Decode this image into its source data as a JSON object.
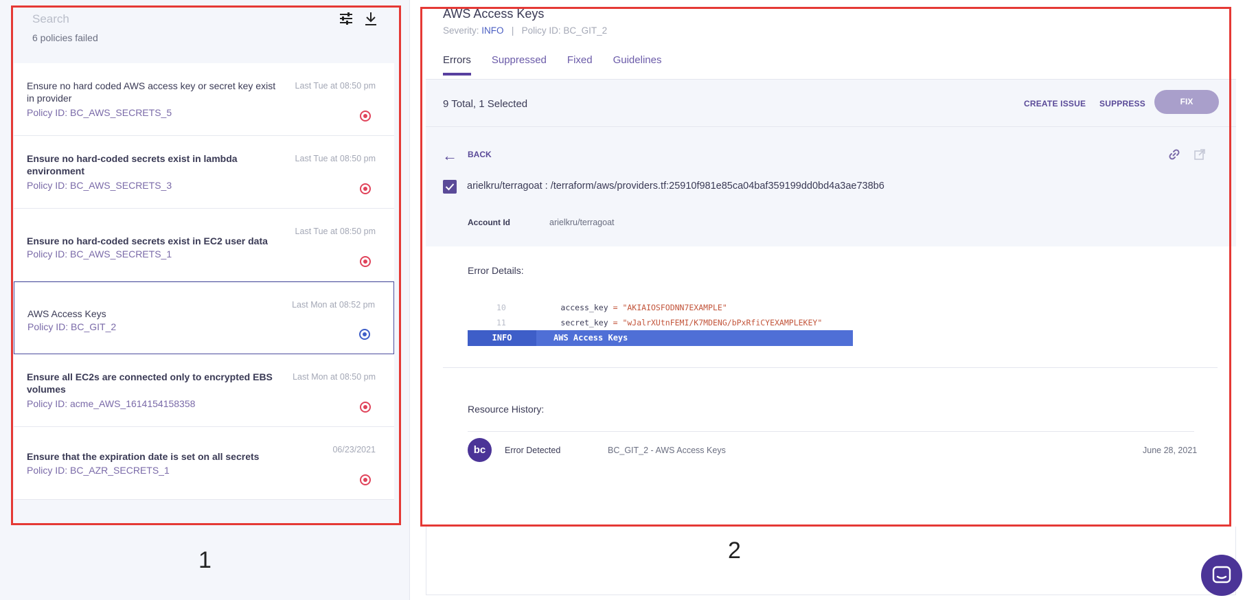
{
  "left": {
    "search_placeholder": "Search",
    "failed_count": "6 policies failed",
    "items": [
      {
        "title": "Ensure no hard coded AWS access key or secret key exist in provider",
        "policy": "Policy ID: BC_AWS_SECRETS_5",
        "time": "Last Tue at 08:50 pm",
        "status": "error"
      },
      {
        "title": "Ensure no hard-coded secrets exist in lambda environment",
        "policy": "Policy ID: BC_AWS_SECRETS_3",
        "time": "Last Tue at 08:50 pm",
        "status": "error"
      },
      {
        "title": "Ensure no hard-coded secrets exist in EC2 user data",
        "policy": "Policy ID: BC_AWS_SECRETS_1",
        "time": "Last Tue at 08:50 pm",
        "status": "error"
      },
      {
        "title": "AWS Access Keys",
        "policy": "Policy ID: BC_GIT_2",
        "time": "Last Mon at 08:52 pm",
        "status": "info"
      },
      {
        "title": "Ensure all EC2s are connected only to encrypted EBS volumes",
        "policy": "Policy ID: acme_AWS_1614154158358",
        "time": "Last Mon at 08:50 pm",
        "status": "error"
      },
      {
        "title": "Ensure that the expiration date is set on all secrets",
        "policy": "Policy ID: BC_AZR_SECRETS_1",
        "time": "06/23/2021",
        "status": "error"
      }
    ]
  },
  "detail": {
    "title": "AWS Access Keys",
    "severity_label": "Severity:",
    "severity_value": "INFO",
    "policy_id": "Policy ID: BC_GIT_2",
    "tabs": [
      "Errors",
      "Suppressed",
      "Fixed",
      "Guidelines"
    ],
    "total": "9 Total, 1 Selected",
    "create_issue": "CREATE ISSUE",
    "suppress": "SUPPRESS",
    "fix": "FIX",
    "back": "BACK",
    "path": "arielkru/terragoat : /terraform/aws/providers.tf:25910f981e85ca04baf359199dd0bd4a3ae738b6",
    "account_label": "Account Id",
    "account_value": "arielkru/terragoat",
    "error_details": "Error Details:",
    "code": [
      {
        "line": "10",
        "key": "access_key",
        "value": "\"AKIAIOSFODNN7EXAMPLE\""
      },
      {
        "line": "11",
        "key": "secret_key",
        "value": "\"wJalrXUtnFEMI/K7MDENG/bPxRfiCYEXAMPLEKEY\""
      }
    ],
    "info_label": "INFO",
    "info_text": "AWS Access Keys",
    "resource_history": "Resource History:",
    "history": [
      {
        "avatar": "bc",
        "event": "Error Detected",
        "policy": "BC_GIT_2 - AWS Access Keys",
        "date": "June 28, 2021"
      }
    ]
  },
  "annotations": {
    "box1": "1",
    "box2": "2"
  },
  "colors": {
    "accent": "#5a4a98",
    "error_dot": "#e0435a",
    "info_dot": "#3e5ec8",
    "annotation_box": "#e53935"
  }
}
